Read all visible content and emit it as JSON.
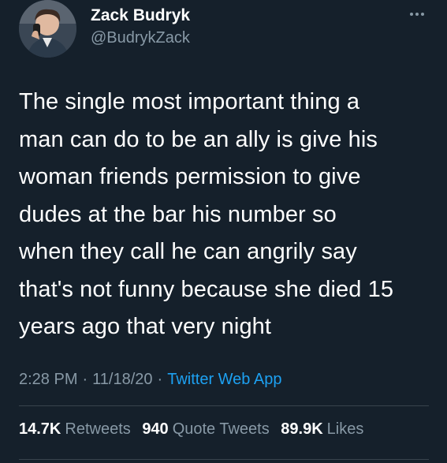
{
  "author": {
    "display_name": "Zack Budryk",
    "handle": "@BudrykZack",
    "avatar_icon": "profile-photo"
  },
  "tweet": {
    "text": "The single most important thing a\nman can do to be an ally is give his\nwoman friends permission to give\ndudes at the bar his number so\nwhen they call he can angrily say\nthat's not funny because she died 15\nyears ago that very night"
  },
  "meta": {
    "time": "2:28 PM",
    "separator": "·",
    "date": "11/18/20",
    "source": "Twitter Web App"
  },
  "stats": {
    "retweets_count": "14.7K",
    "retweets_label": "Retweets",
    "quotes_count": "940",
    "quotes_label": "Quote Tweets",
    "likes_count": "89.9K",
    "likes_label": "Likes"
  },
  "colors": {
    "background": "#15202b",
    "text": "#ffffff",
    "secondary": "#8899a6",
    "link": "#1da1f2",
    "divider": "#38444d"
  },
  "icons": {
    "more": "more-horizontal-icon"
  }
}
